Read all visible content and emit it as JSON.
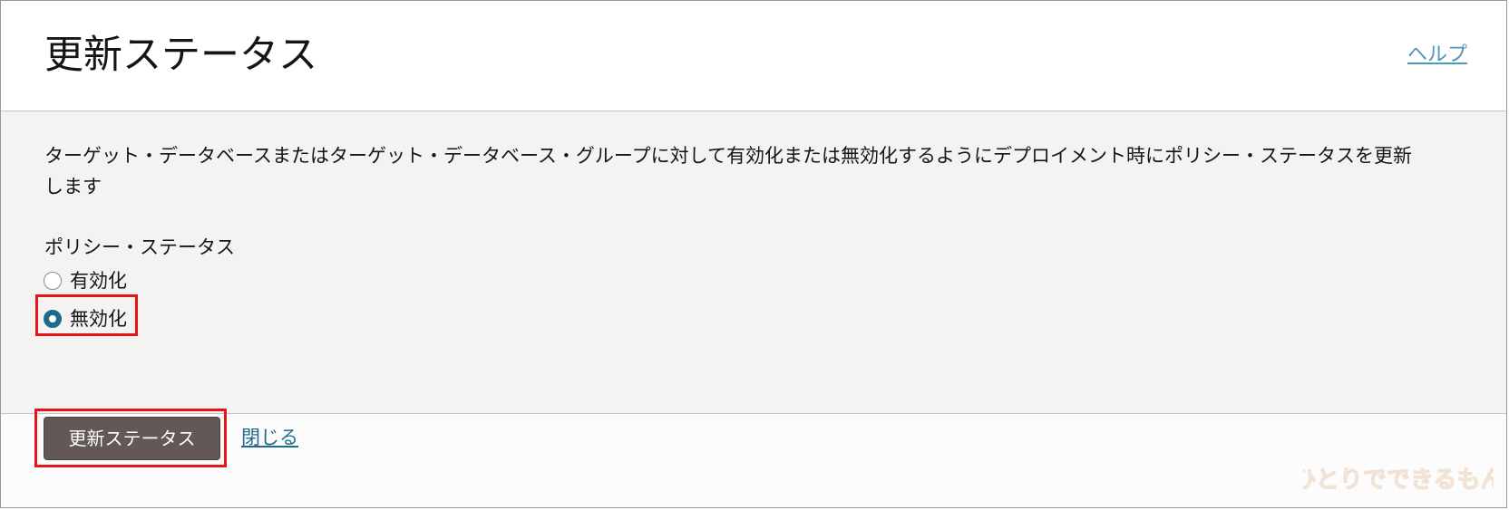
{
  "header": {
    "title": "更新ステータス",
    "help_label": "ヘルプ"
  },
  "body": {
    "description": "ターゲット・データベースまたはターゲット・データベース・グループに対して有効化または無効化するようにデプロイメント時にポリシー・ステータスを更新します",
    "policy_status": {
      "label": "ポリシー・ステータス",
      "options": [
        {
          "label": "有効化",
          "checked": false
        },
        {
          "label": "無効化",
          "checked": true
        }
      ]
    }
  },
  "footer": {
    "update_button_label": "更新ステータス",
    "close_label": "閉じる"
  },
  "watermark": {
    "text": "ひとりでできるもん"
  },
  "colors": {
    "primary_button": "#625855",
    "radio_selected": "#1f6b8c",
    "link": "#1f6b8c",
    "highlight": "#e8141b",
    "body_background": "#f4f3f2"
  }
}
